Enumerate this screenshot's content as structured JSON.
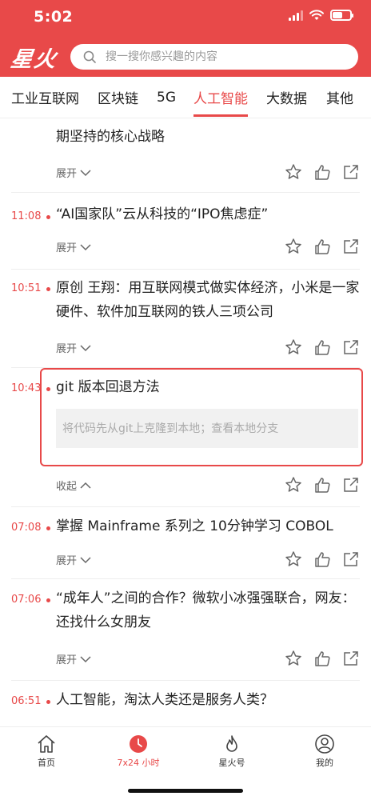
{
  "status_bar": {
    "time": "5:02"
  },
  "header": {
    "logo": "星火",
    "search_placeholder": "搜一搜你感兴趣的内容"
  },
  "tabs": [
    {
      "label": "工业互联网"
    },
    {
      "label": "区块链"
    },
    {
      "label": "5G"
    },
    {
      "label": "人工智能",
      "active": true
    },
    {
      "label": "大数据"
    },
    {
      "label": "其他"
    }
  ],
  "feed": {
    "items": [
      {
        "time": "",
        "title": "期坚持的核心战略",
        "toggle": "展开"
      },
      {
        "time": "11:08",
        "title": "“AI国家队”云从科技的“IPO焦虑症”",
        "toggle": "展开"
      },
      {
        "time": "10:51",
        "title": "原创 王翔：用互联网模式做实体经济，小米是一家硬件、软件加互联网的铁人三项公司",
        "toggle": "展开"
      },
      {
        "time": "10:43",
        "title": "git 版本回退方法",
        "detail": "将代码先从git上克隆到本地；查看本地分支",
        "toggle": "收起"
      },
      {
        "time": "07:08",
        "title": "掌握 Mainframe 系列之 10分钟学习 COBOL",
        "toggle": "展开"
      },
      {
        "time": "07:06",
        "title": "“成年人”之间的合作？微软小冰强强联合，网友：还找什么女朋友",
        "toggle": "展开"
      },
      {
        "time": "06:51",
        "title": "人工智能，淘汰人类还是服务人类？",
        "toggle": ""
      }
    ]
  },
  "bottom_nav": [
    {
      "label": "首页",
      "icon": "home-icon"
    },
    {
      "label": "7x24 小时",
      "icon": "clock-icon",
      "active": true
    },
    {
      "label": "星火号",
      "icon": "flame-icon"
    },
    {
      "label": "我的",
      "icon": "user-icon"
    }
  ],
  "colors": {
    "accent": "#e84949",
    "divider": "#eeeeee",
    "detail_bg": "#f1f1f1"
  }
}
